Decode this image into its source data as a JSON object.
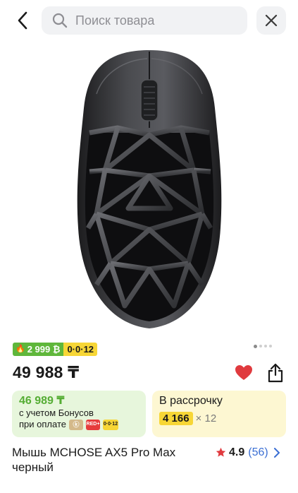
{
  "search": {
    "placeholder": "Поиск товара"
  },
  "promo": {
    "bonus_label": "2 999 ₿",
    "installment_label": "0·0·12"
  },
  "price": "49 988 ₸",
  "bonus_card": {
    "price": "46 989 ₸",
    "line1": "с учетом Бонусов",
    "line2": "при оплате",
    "pay_logos": [
      "kaspi",
      "RED+",
      "0·0·12"
    ]
  },
  "installment_card": {
    "title": "В рассрочку",
    "amount": "4 166",
    "months": "× 12"
  },
  "product": {
    "title": "Мышь MCHOSE AX5 Pro Max черный"
  },
  "rating": {
    "value": "4.9",
    "count": "(56)"
  },
  "colors": {
    "bonus_green": "#5fb73b",
    "install_yellow": "#f7d636",
    "heart_red": "#e03a3e",
    "link_blue": "#3b6fd4",
    "star_red": "#e03a3e"
  },
  "icons": [
    "chevron-left-icon",
    "search-icon",
    "close-icon",
    "heart-icon",
    "share-icon",
    "star-icon",
    "chevron-right-icon"
  ]
}
